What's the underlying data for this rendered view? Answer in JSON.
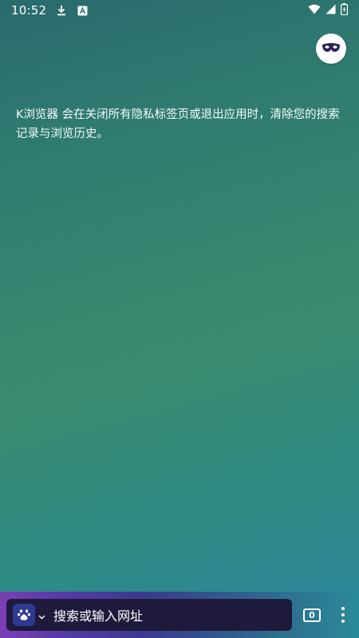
{
  "status_bar": {
    "time": "10:52",
    "icons_left": [
      "download-icon",
      "app-notification-icon"
    ],
    "icons_right": [
      "wifi-icon",
      "signal-icon",
      "battery-icon"
    ]
  },
  "incognito": {
    "icon": "incognito-mask-icon"
  },
  "notice": {
    "text": "K浏览器 会在关闭所有隐私标签页或退出应用时，清除您的搜索记录与浏览历史。"
  },
  "bottom_bar": {
    "search_placeholder": "搜索或输入网址",
    "engine_icon": "baidu-paw-icon",
    "tab_count": "0",
    "menu_icon": "more-vertical-icon"
  },
  "colors": {
    "background_top": "#2a6a6d",
    "background_mid": "#3a8c6f",
    "background_bottom": "#2c86a3",
    "search_box": "#1e1a3c",
    "bottom_bar_start": "#7b3fb3",
    "engine_logo": "#2d3a8f"
  }
}
